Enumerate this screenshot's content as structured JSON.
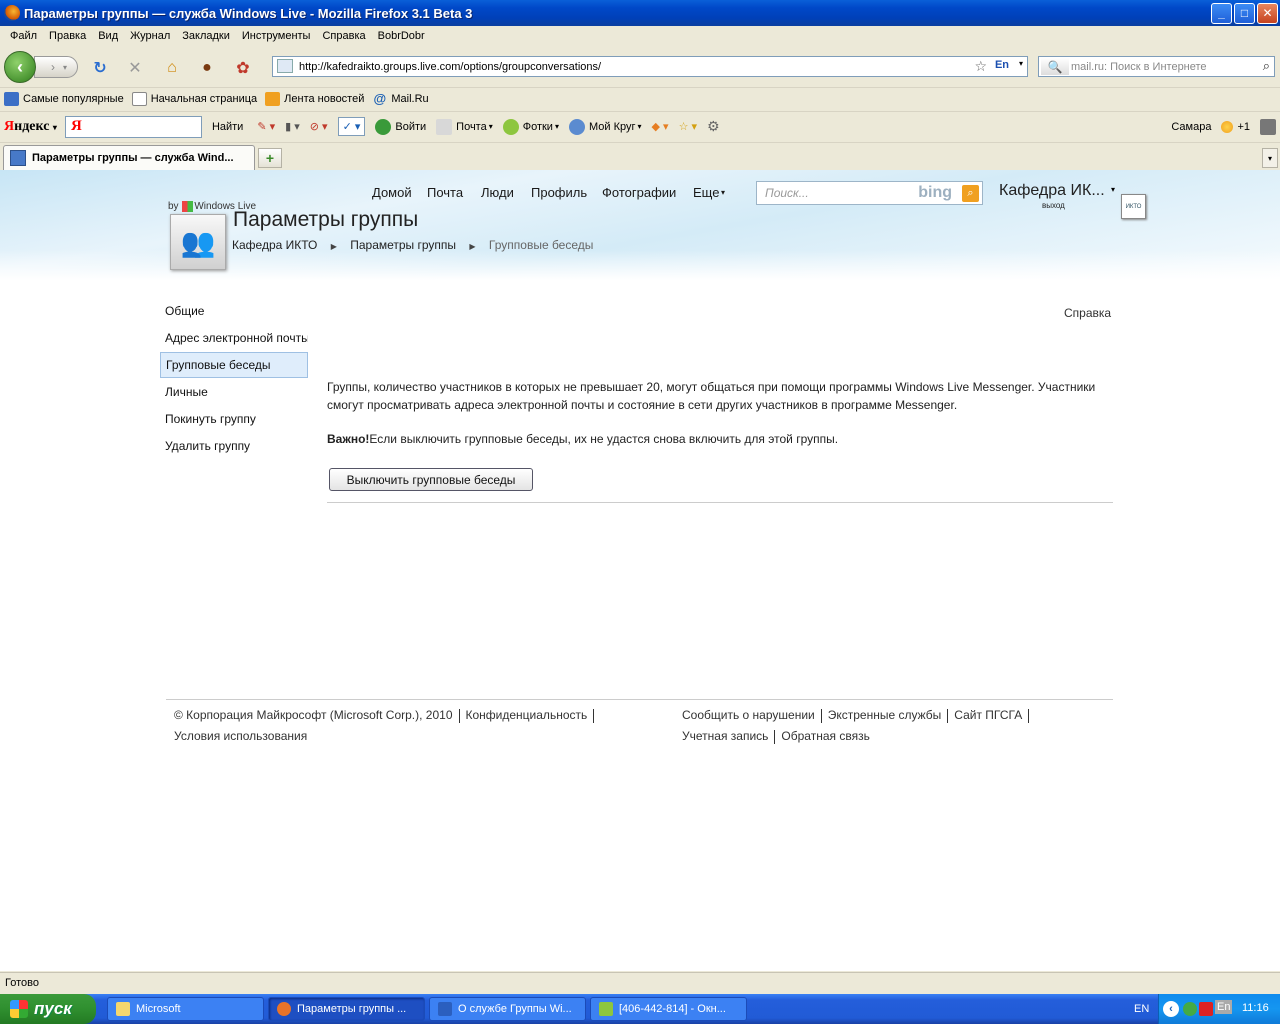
{
  "window": {
    "title": "Параметры группы — служба Windows Live - Mozilla Firefox 3.1 Beta 3",
    "controls": {
      "minimize": "_",
      "maximize": "□",
      "close": "✕"
    }
  },
  "menu": [
    "Файл",
    "Правка",
    "Вид",
    "Журнал",
    "Закладки",
    "Инструменты",
    "Справка",
    "BobrDobr"
  ],
  "navbar": {
    "url": "http://kafedraikto.groups.live.com/options/groupconversations/",
    "lang_indicator": "En",
    "search_placeholder": "mail.ru: Поиск в Интернете"
  },
  "bookmarks": [
    {
      "label": "Самые популярные",
      "icon": "bookmark-icon",
      "color": "#3b6fc6"
    },
    {
      "label": "Начальная страница",
      "icon": "page-icon",
      "color": "#ffffff"
    },
    {
      "label": "Лента новостей",
      "icon": "rss-icon",
      "color": "#f0a020"
    },
    {
      "label": "Mail.Ru",
      "icon": "at-icon",
      "color": "#1a5fb4"
    }
  ],
  "yandex_bar": {
    "logo_ya": "Я",
    "logo_rest": "ндекс",
    "find": "Найти",
    "login": "Войти",
    "mail": "Почта",
    "photos": "Фотки",
    "circle": "Мой Круг",
    "city": "Самара",
    "temp": "+1"
  },
  "tab": {
    "title": "Параметры группы — служба Wind..."
  },
  "page": {
    "nav": [
      "Домой",
      "Почта",
      "Люди",
      "Профиль",
      "Фотографии",
      "Еще"
    ],
    "nav_more_arrow": "▾",
    "search_placeholder": "Поиск...",
    "search_brand": "bing",
    "account_name": "Кафедра ИК...",
    "account_logout": "выход",
    "account_pic_text": "ИКТО",
    "by": "by",
    "by_brand": "Windows Live",
    "title": "Параметры группы",
    "breadcrumb": [
      "Кафедра ИКТО",
      "Параметры группы",
      "Групповые беседы"
    ],
    "breadcrumb_sep": "▶",
    "sidebar": [
      "Общие",
      "Адрес электронной почты",
      "Групповые беседы",
      "Личные",
      "Покинуть группу",
      "Удалить группу"
    ],
    "sidebar_active_index": 2,
    "help": "Справка",
    "description": "Группы, количество участников в которых не превышает 20, могут общаться при помощи программы Windows Live Messenger. Участники смогут просматривать адреса электронной почты и состояние в сети других участников в программе Messenger.",
    "warning_label": "Важно!",
    "warning_text": "Если выключить групповые беседы, их не удастся снова включить для этой группы.",
    "disable_button": "Выключить групповые беседы",
    "footer": {
      "copyright": "© Корпорация Майкрософт (Microsoft Corp.), 2010",
      "privacy": "Конфиденциальность",
      "terms": "Условия использования",
      "report": "Сообщить о нарушении",
      "emergency": "Экстренные службы",
      "site": "Сайт ПГСГА",
      "account": "Учетная запись",
      "feedback": "Обратная связь"
    }
  },
  "status": "Готово",
  "taskbar": {
    "start": "пуск",
    "tasks": [
      {
        "label": "Microsoft",
        "icon": "folder-icon",
        "color": "#f5d76e"
      },
      {
        "label": "Параметры группы ...",
        "icon": "firefox-icon",
        "color": "#e8732a"
      },
      {
        "label": "О службе Группы Wi...",
        "icon": "word-icon",
        "color": "#2b5fbf"
      },
      {
        "label": "[406-442-814] - Окн...",
        "icon": "icq-icon",
        "color": "#8dc63f"
      }
    ],
    "lang": "EN",
    "tray_lang": "En",
    "clock": "11:16"
  }
}
